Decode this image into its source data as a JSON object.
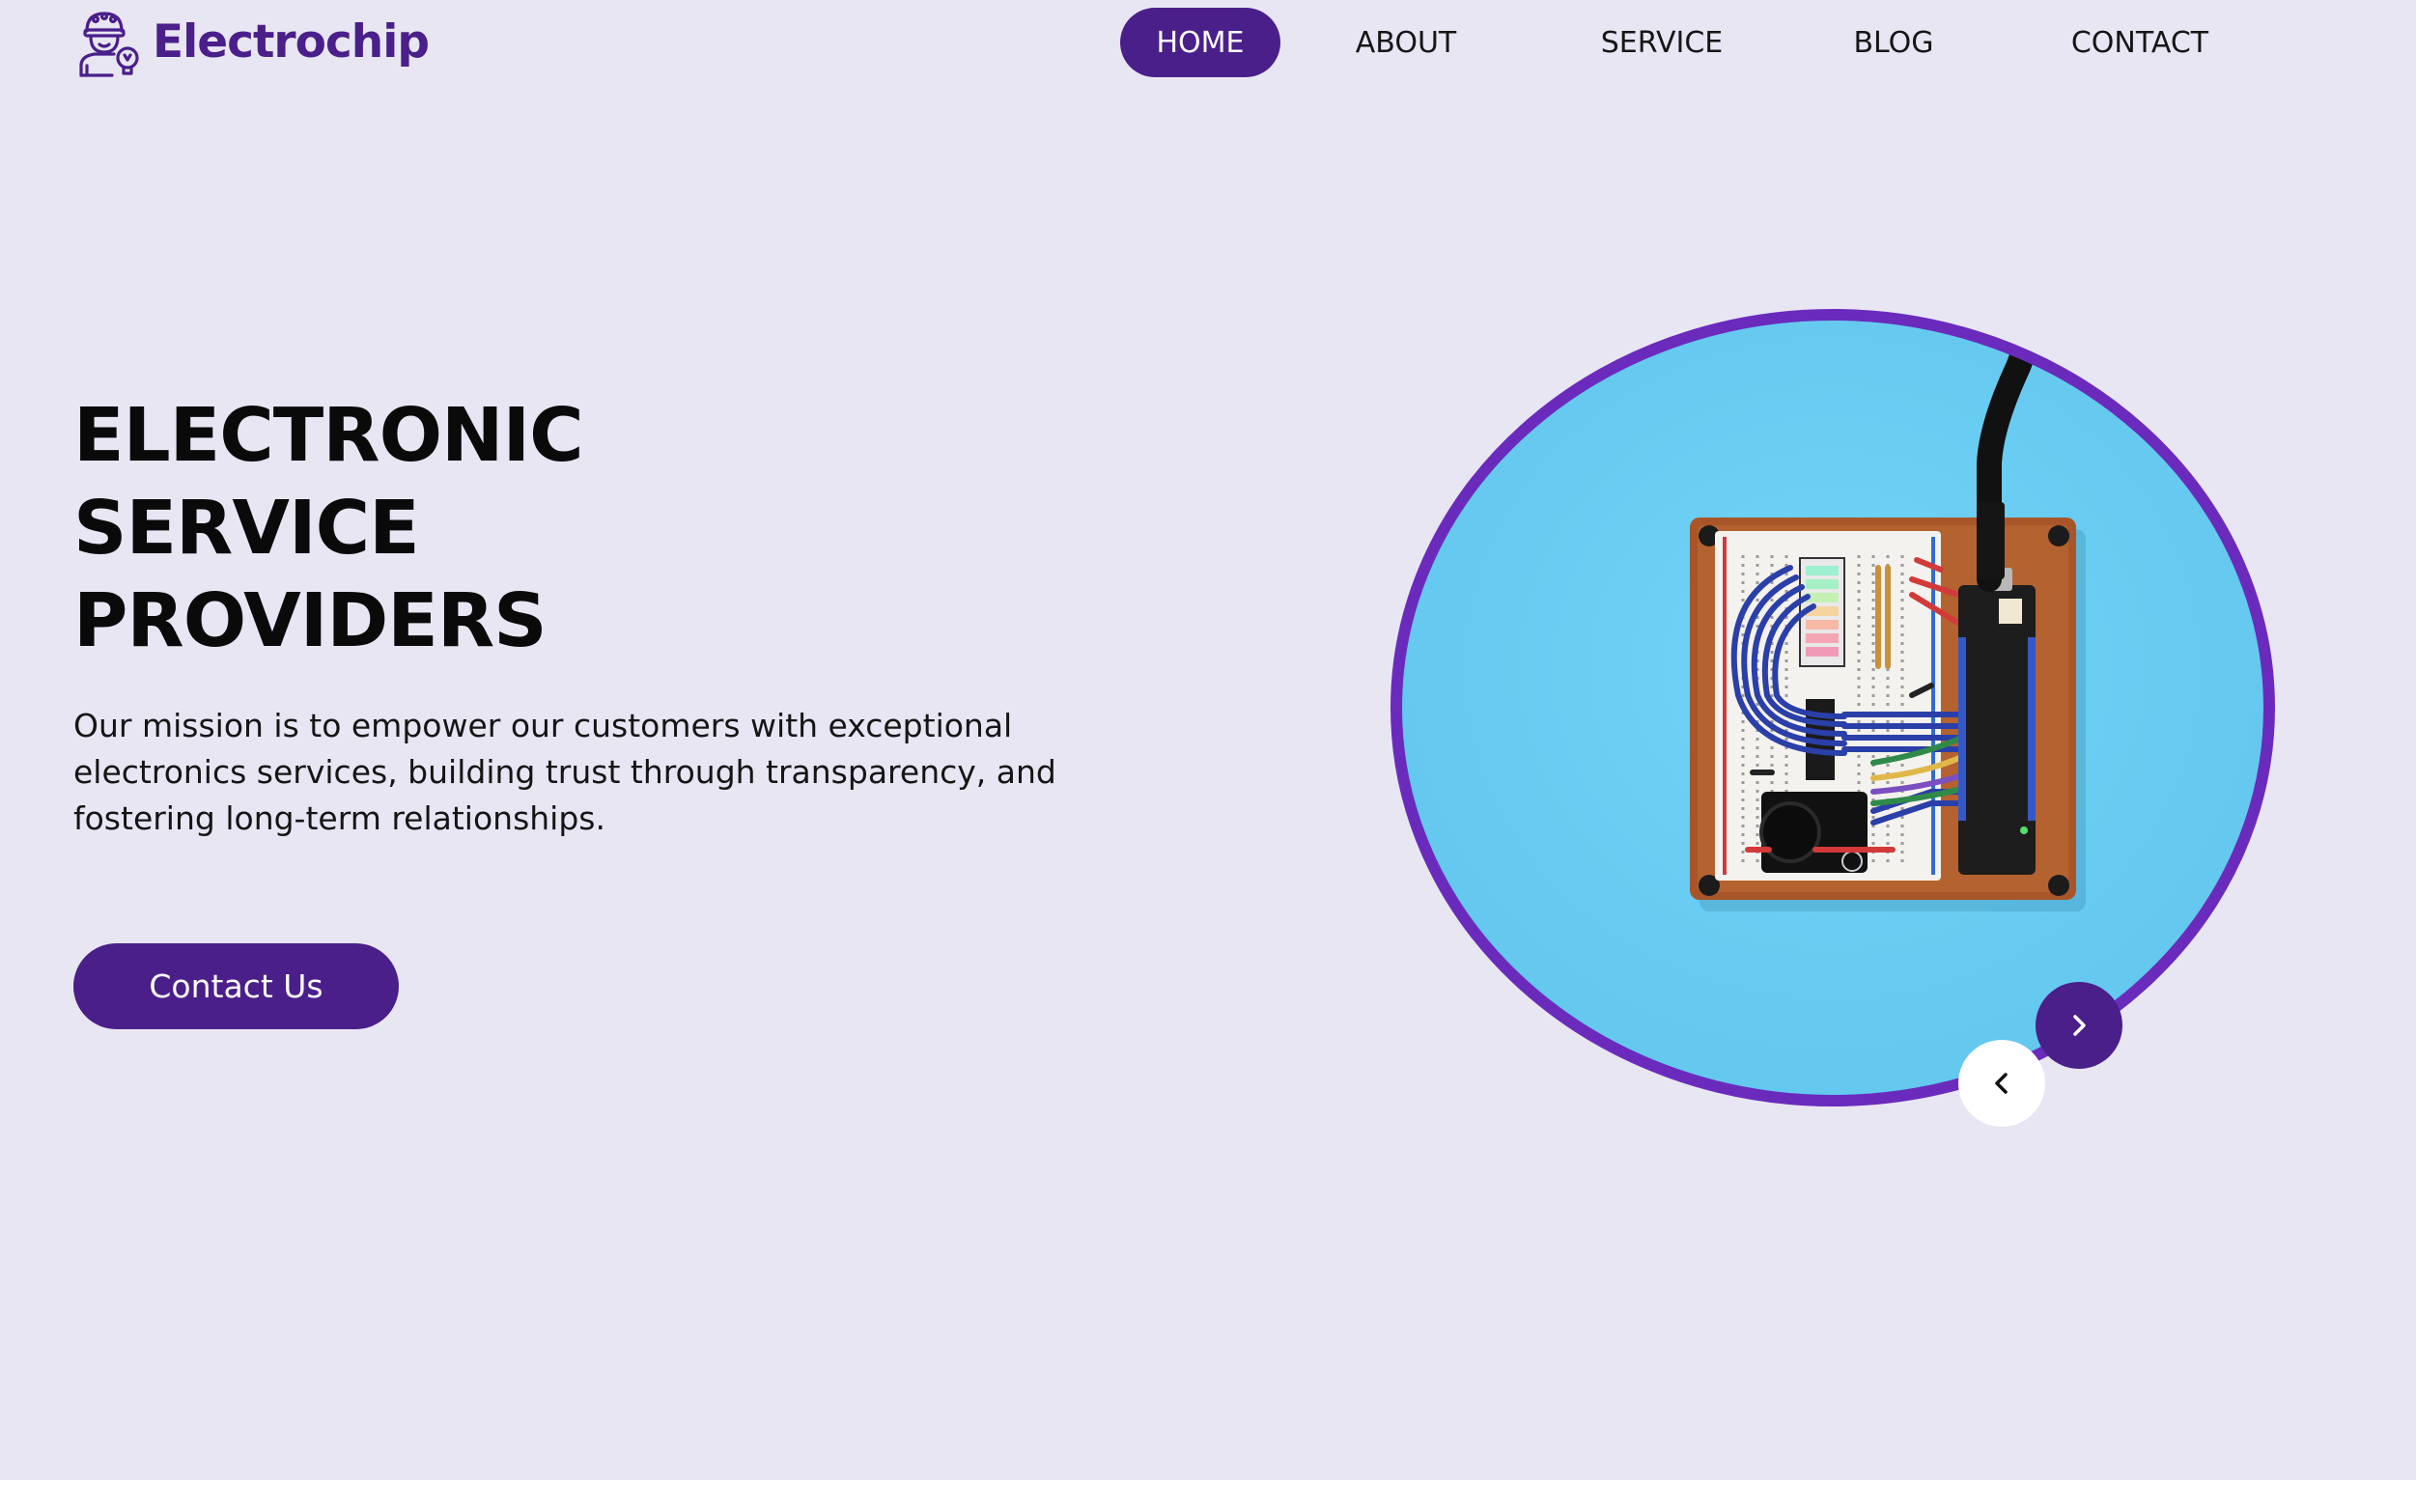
{
  "brand": {
    "name": "Electrochip",
    "icon": "engineer-with-bulb-icon",
    "color": "#4a1f8a"
  },
  "nav": {
    "items": [
      {
        "label": "HOME",
        "active": true
      },
      {
        "label": "ABOUT",
        "active": false
      },
      {
        "label": "SERVICE",
        "active": false
      },
      {
        "label": "BLOG",
        "active": false
      },
      {
        "label": "CONTACT",
        "active": false
      }
    ]
  },
  "hero": {
    "headline": [
      "ELECTRONIC",
      "SERVICE",
      "PROVIDERS"
    ],
    "mission": "Our mission is to empower our customers with exceptional electronics services, building trust through transparency, and fostering long-term relationships.",
    "cta_label": "Contact Us",
    "image": "breadboard-circuit-photo",
    "prev_icon": "chevron-left-icon",
    "next_icon": "chevron-right-icon"
  },
  "colors": {
    "background": "#e8e6f3",
    "accent": "#4a1f8a",
    "ring": "#6a2bbd",
    "image_bg": "#6ccff2"
  }
}
